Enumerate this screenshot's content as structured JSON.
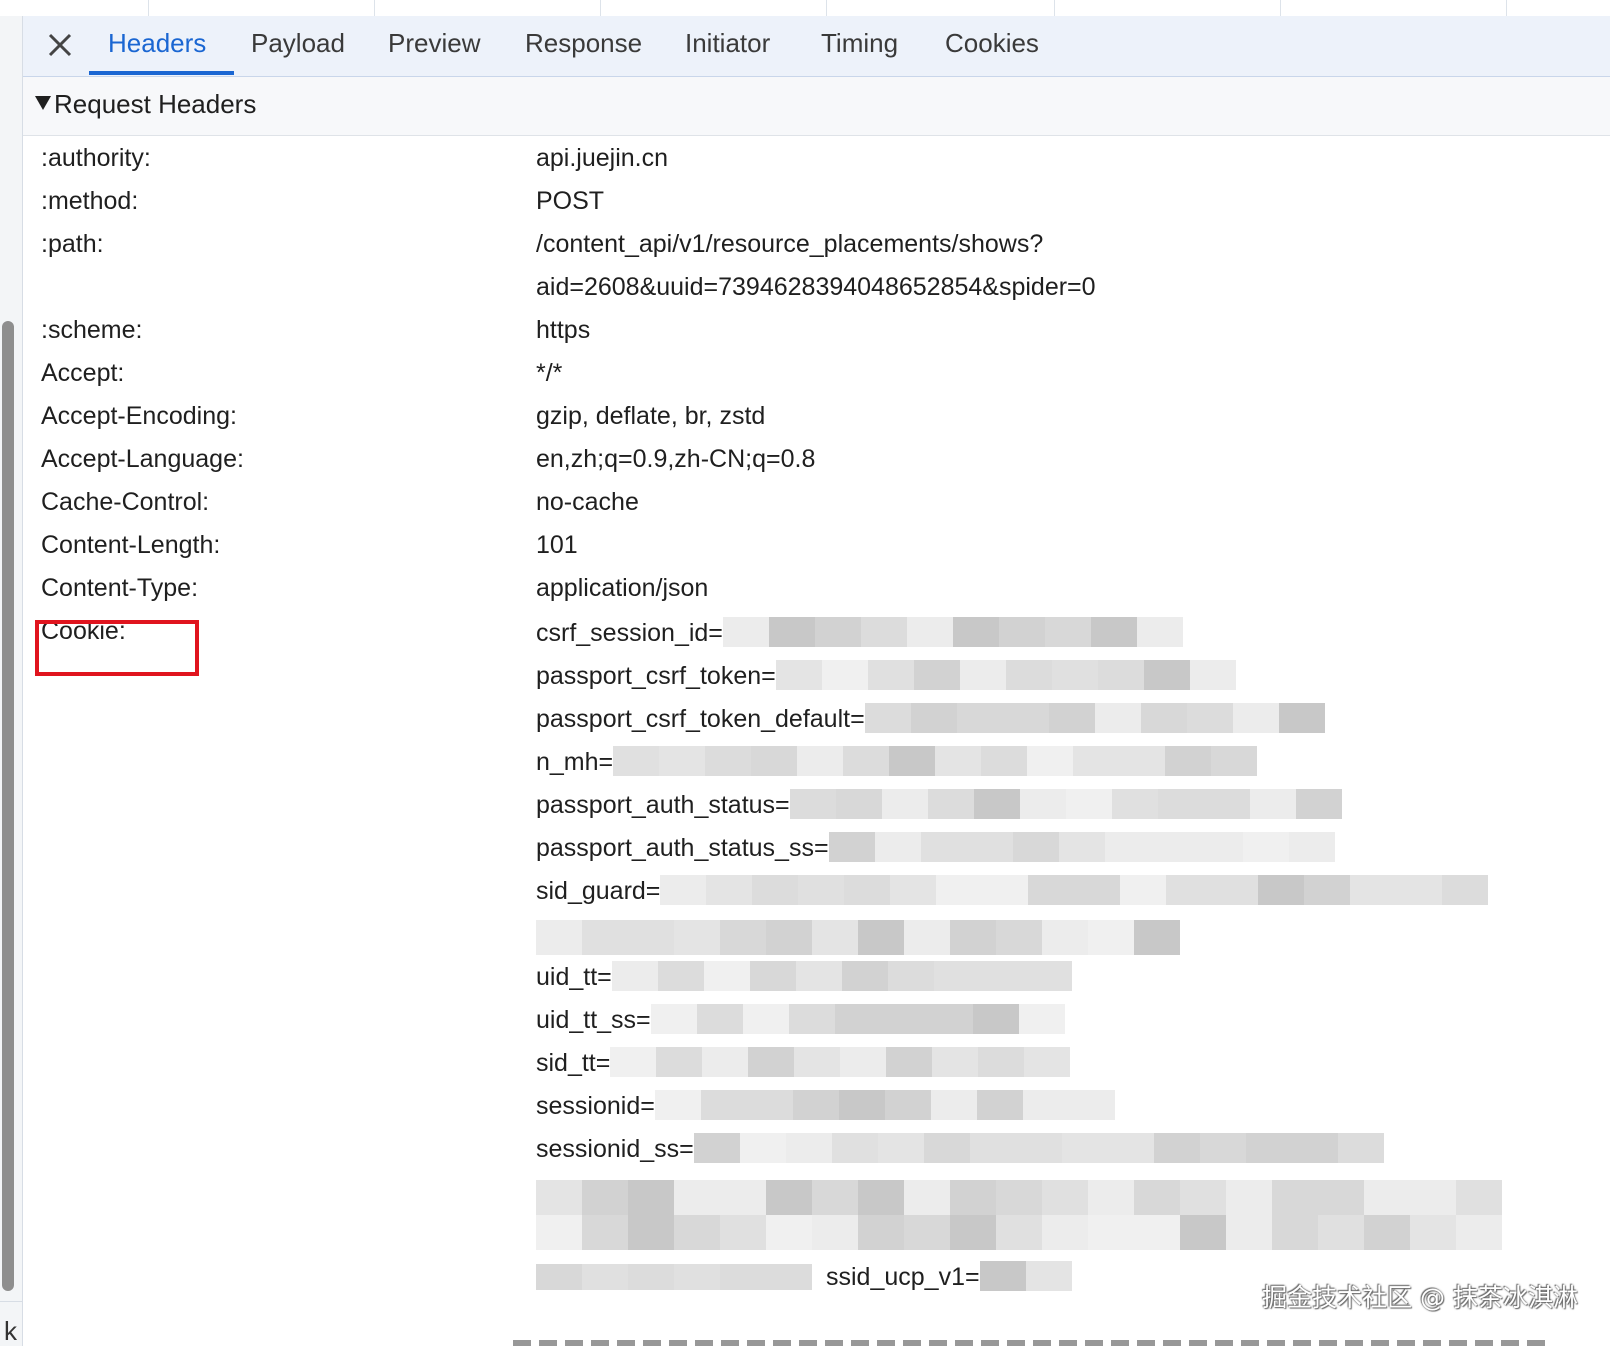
{
  "tabs": [
    {
      "label": "Headers",
      "active": true
    },
    {
      "label": "Payload",
      "active": false
    },
    {
      "label": "Preview",
      "active": false
    },
    {
      "label": "Response",
      "active": false
    },
    {
      "label": "Initiator",
      "active": false
    },
    {
      "label": "Timing",
      "active": false
    },
    {
      "label": "Cookies",
      "active": false
    }
  ],
  "section": {
    "title": "Request Headers",
    "expanded": true
  },
  "headers": [
    {
      "name": ":authority:",
      "value": "api.juejin.cn"
    },
    {
      "name": ":method:",
      "value": "POST"
    },
    {
      "name": ":path:",
      "value": "/content_api/v1/resource_placements/shows?",
      "value_line2": "aid=2608&uuid=7394628394048652854&spider=0"
    },
    {
      "name": ":scheme:",
      "value": "https"
    },
    {
      "name": "Accept:",
      "value": "*/*"
    },
    {
      "name": "Accept-Encoding:",
      "value": "gzip, deflate, br, zstd"
    },
    {
      "name": "Accept-Language:",
      "value": "en,zh;q=0.9,zh-CN;q=0.8"
    },
    {
      "name": "Cache-Control:",
      "value": "no-cache"
    },
    {
      "name": "Content-Length:",
      "value": "101"
    },
    {
      "name": "Content-Type:",
      "value": "application/json"
    },
    {
      "name": "Cookie:",
      "value": ""
    }
  ],
  "cookie_parts": [
    {
      "key": "csrf_session_id="
    },
    {
      "key": "passport_csrf_token="
    },
    {
      "key": "passport_csrf_token_default="
    },
    {
      "key": "n_mh="
    },
    {
      "key": "passport_auth_status="
    },
    {
      "key": "passport_auth_status_ss="
    },
    {
      "key": "sid_guard="
    },
    {
      "key": "uid_tt="
    },
    {
      "key": "uid_tt_ss="
    },
    {
      "key": "sid_tt="
    },
    {
      "key": "sessionid="
    },
    {
      "key": "sessionid_ss="
    },
    {
      "key": "ssid_ucp_v1="
    }
  ],
  "highlight_color": "#e0141e",
  "accent_color": "#1a66d2",
  "icons": {
    "close": "close-icon",
    "expand": "triangle-down-icon"
  },
  "gutter_char": "k",
  "watermark": "掘金技术社区 @ 抹茶冰淇淋"
}
